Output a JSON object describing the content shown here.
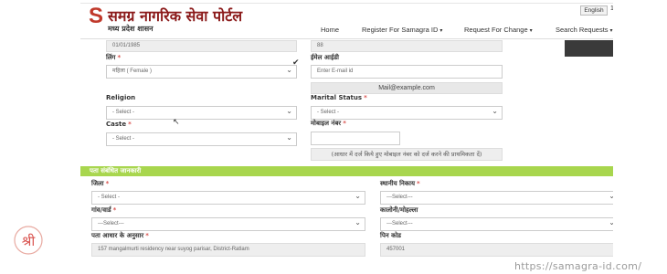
{
  "header": {
    "logo_letter": "S",
    "title": "समग्र नागरिक सेवा पोर्टल",
    "subtitle": "मध्य प्रदेश शासन",
    "language_button": "English",
    "language_extra": "1",
    "nav": [
      {
        "label": "Home"
      },
      {
        "label": "Register For Samagra ID"
      },
      {
        "label": "Request For Change"
      },
      {
        "label": "Search Requests"
      }
    ]
  },
  "form": {
    "dob_value": "01/01/1985",
    "age_value": "88",
    "gender": {
      "label": "लिंग",
      "value": "महिला ( Female )"
    },
    "email": {
      "label": "ईमेल आईडी",
      "placeholder": "Enter E-mail id",
      "display": "Mail@example.com"
    },
    "religion": {
      "label": "Religion",
      "value": "- Select -"
    },
    "marital": {
      "label": "Marital Status",
      "value": "- Select -"
    },
    "caste": {
      "label": "Caste",
      "value": "- Select -"
    },
    "mobile": {
      "label": "मोबाइल नंबर",
      "value": ""
    },
    "mobile_hint": "(आधार में दर्ज किये हुए मोबाइल नंबर को दर्ज करने की प्राथमिकता दें)"
  },
  "address": {
    "section_title": "पता संबंधित जानकारी",
    "district": {
      "label": "जिला",
      "value": "- Select -"
    },
    "local_body": {
      "label": "स्थानीय निकाय",
      "value": "---Select---"
    },
    "village_ward": {
      "label": "गांव/वार्ड",
      "value": "---Select---"
    },
    "colony": {
      "label": "कालोनी/मोहल्ला",
      "value": "---Select---"
    },
    "aadhaar_address": {
      "label": "पता आधार के अनुसार",
      "value": "157 mangalmurti residency near suyog parisar, District-Ratlam"
    },
    "pincode": {
      "label": "पिन कोड",
      "value": "457001"
    }
  },
  "watermark": {
    "logo_glyph": "श्री",
    "url": "https://samagra-id.com/"
  },
  "colors": {
    "section_bar": "#a8d64e",
    "required": "#d9534f",
    "brand": "#c0392b"
  }
}
